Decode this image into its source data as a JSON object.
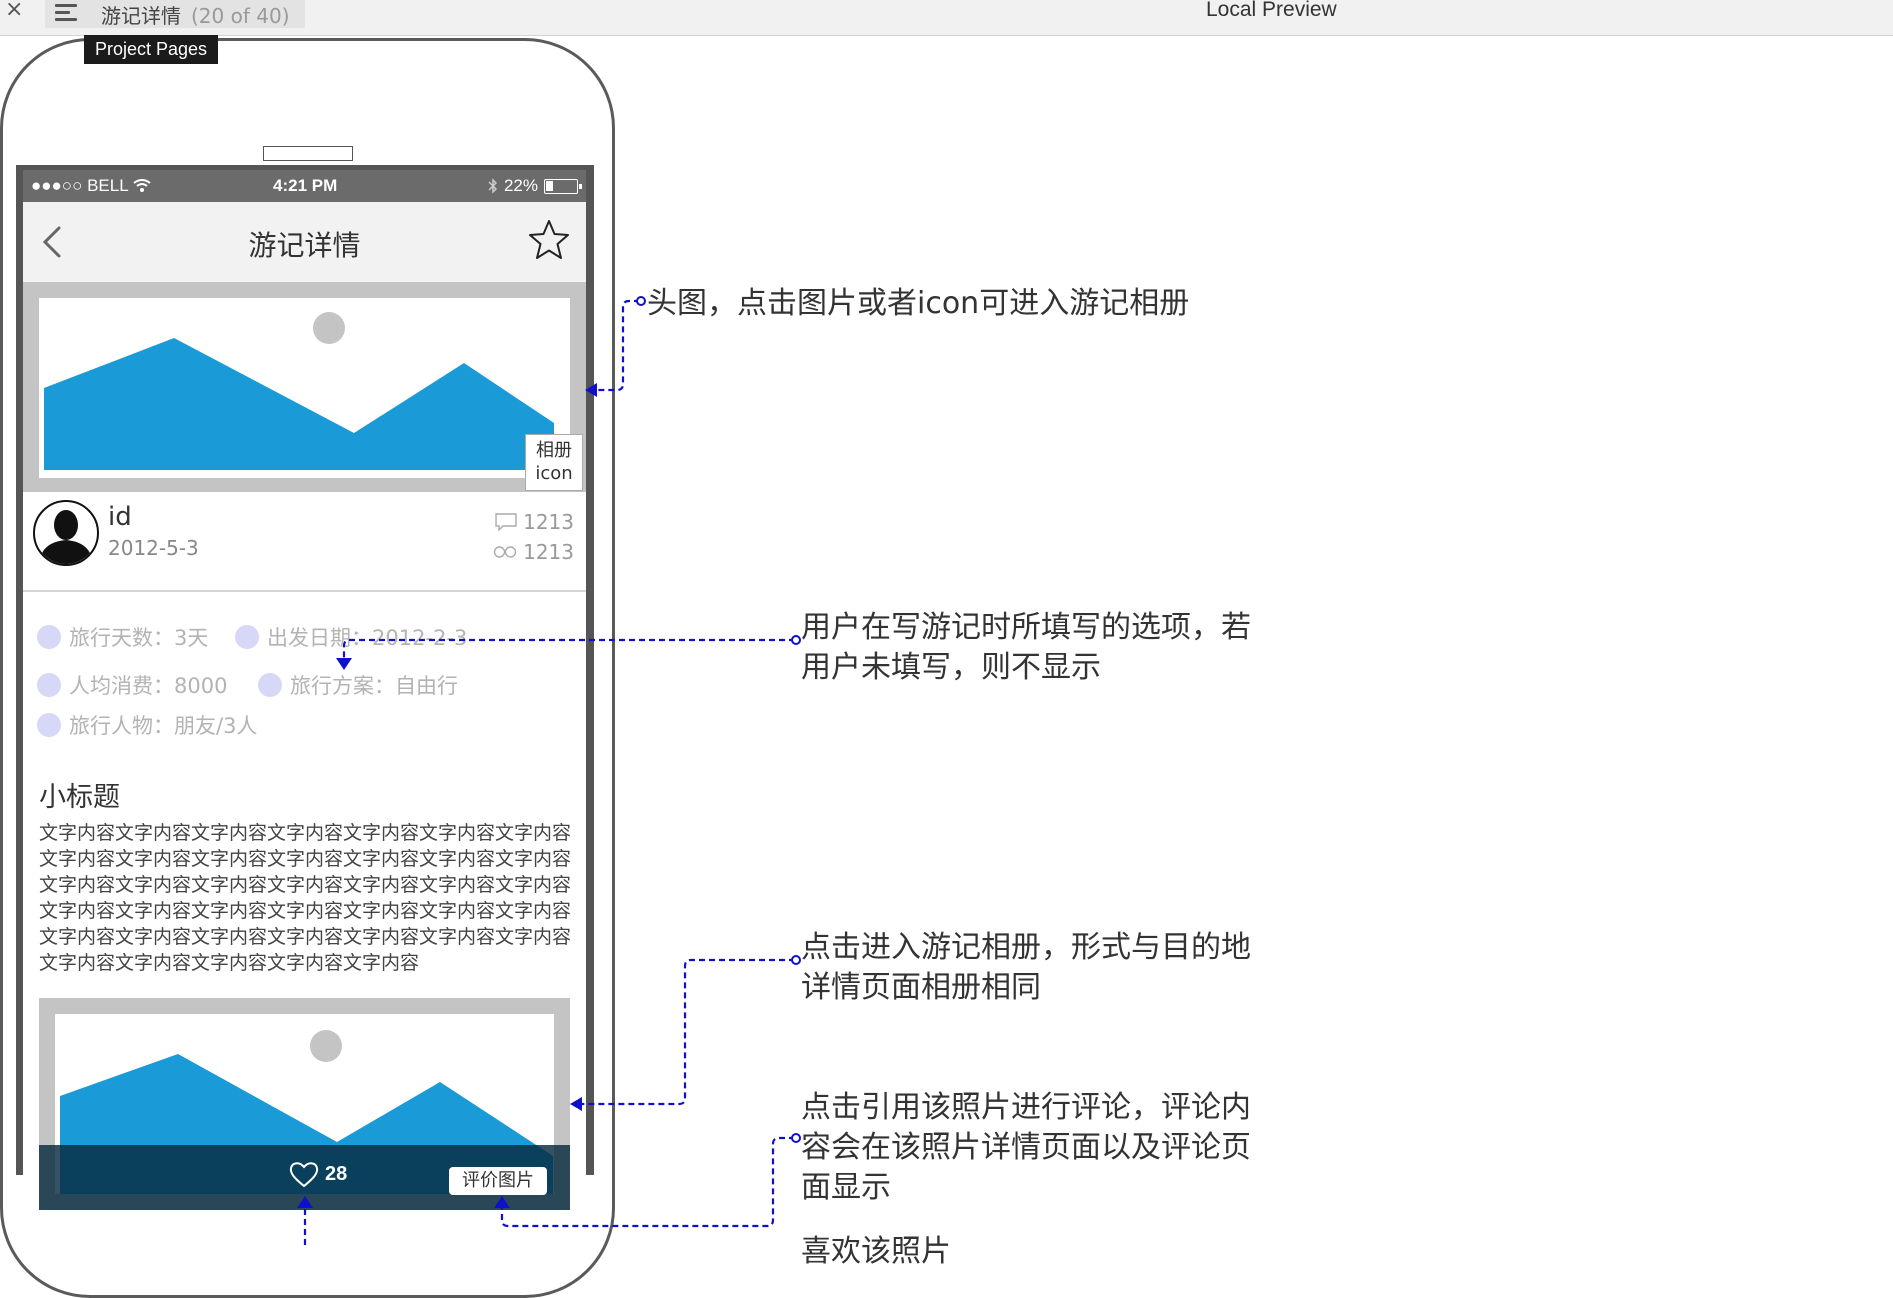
{
  "topbar": {
    "page_name": "游记详情",
    "page_count": "(20 of 40)",
    "preview_title": "Local Preview",
    "tooltip": "Project Pages"
  },
  "statusbar": {
    "carrier": "●●●○○ BELL",
    "time": "4:21 PM",
    "battery": "22%"
  },
  "navbar": {
    "title": "游记详情"
  },
  "hero": {
    "album_label_1": "相册",
    "album_label_2": "icon"
  },
  "user": {
    "id": "id",
    "date": "2012-5-3",
    "comments": "1213",
    "views": "1213"
  },
  "info": {
    "days": "旅行天数：3天",
    "depart": "出发日期：2012-2-3",
    "cost": "人均消费：8000",
    "plan": "旅行方案：自由行",
    "people": "旅行人物：朋友/3人"
  },
  "content": {
    "subtitle": "小标题",
    "body": "文字内容文字内容文字内容文字内容文字内容文字内容文字内容文字内容文字内容文字内容文字内容文字内容文字内容文字内容文字内容文字内容文字内容文字内容文字内容文字内容文字内容文字内容文字内容文字内容文字内容文字内容文字内容文字内容文字内容文字内容文字内容文字内容文字内容文字内容文字内容文字内容文字内容文字内容文字内容文字内容"
  },
  "photo2": {
    "likes": "28",
    "comment_button": "评价图片"
  },
  "annotations": {
    "a1": "头图，点击图片或者icon可进入游记相册",
    "a2_line1": "用户在写游记时所填写的选项，若",
    "a2_line2": "用户未填写，则不显示",
    "a3_line1": "点击进入游记相册，形式与目的地",
    "a3_line2": "详情页面相册相同",
    "a4_line1": "点击引用该照片进行评论，评论内",
    "a4_line2": "容会在该照片详情页面以及评论页",
    "a4_line3": "面显示",
    "a5": "喜欢该照片"
  },
  "colors": {
    "mountain": "#1a9ad6",
    "sun": "#c4c4c4",
    "connector": "#1010cc",
    "info_dot": "#d7d7f7"
  },
  "icons": [
    "close-icon",
    "menu-icon",
    "wifi-icon",
    "bluetooth-icon",
    "battery-icon",
    "back-icon",
    "star-icon",
    "comment-icon",
    "views-icon",
    "heart-icon"
  ]
}
